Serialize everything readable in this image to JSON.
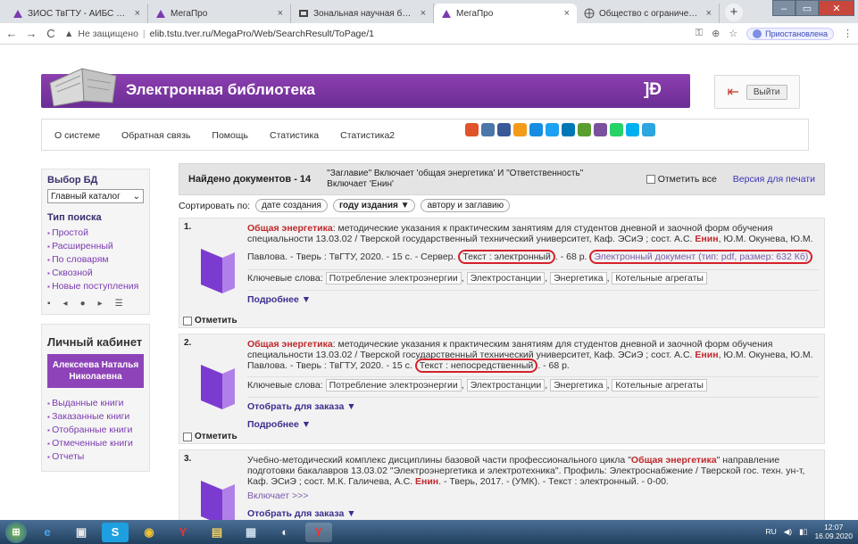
{
  "browser": {
    "tabs": [
      {
        "title": "ЗИОС ТвГТУ - АИБС МегаПро",
        "active": false,
        "icon": "megapro-icon"
      },
      {
        "title": "МегаПро",
        "active": false,
        "icon": "megapro-icon"
      },
      {
        "title": "Зональная научная библиотека",
        "active": false,
        "icon": "library-icon"
      },
      {
        "title": "МегаПро",
        "active": true,
        "icon": "megapro-icon"
      },
      {
        "title": "Общество с ограниченной отве",
        "active": false,
        "icon": "globe-icon"
      }
    ],
    "new_tab": "+",
    "not_secure_label": "Не защищено",
    "url": "elib.tstu.tver.ru/MegaPro/Web/SearchResult/ToPage/1",
    "profile_label": "Приостановлена"
  },
  "header": {
    "title": "Электронная библиотека",
    "mark": "]Ð",
    "logout_label": "Выйти"
  },
  "nav": {
    "items": [
      "О системе",
      "Обратная связь",
      "Помощь",
      "Статистика",
      "Статистика2"
    ],
    "social_colors": [
      "#e0532b",
      "#4a76a8",
      "#3b5998",
      "#f49c1a",
      "#168de2",
      "#1da1f2",
      "#0077b5",
      "#5a9e2f",
      "#7b519d",
      "#25d366",
      "#00aff0",
      "#2ca5e0"
    ]
  },
  "sidebar": {
    "db_heading": "Выбор БД",
    "db_selected": "Главный каталог",
    "search_heading": "Тип поиска",
    "search_types": [
      "Простой",
      "Расширенный",
      "По словарям",
      "Сквозной",
      "Новые поступления"
    ],
    "cabinet_heading": "Личный кабинет",
    "user_name": "Алексеева Наталья Николаевна",
    "cabinet_links": [
      "Выданные книги",
      "Заказанные книги",
      "Отобранные книги",
      "Отмеченные книги",
      "Отчеты"
    ]
  },
  "results": {
    "found_label": "Найдено документов - 14",
    "query_text": "\"Заглавие\" Включает 'общая энергетика' И \"Ответственность\" Включает 'Енин'",
    "mark_all": "Отметить все",
    "print_version": "Версия для печати",
    "sort_label": "Сортировать по:",
    "sort_options": [
      "дате создания",
      "году издания ▼",
      "автору и заглавию"
    ],
    "mark_label": "Отметить",
    "records": [
      {
        "num": "1.",
        "title": "Общая энергетика",
        "text_a": ": методические указания к практическим занятиям для студентов дневной и заочной форм обучения специальности 13.03.02 / Тверской государственный технический университет, Каф. ЭСиЭ ; сост. А.С. ",
        "author_hl": "Енин",
        "text_b": ", Ю.М. Окунева, Ю.М. Павлова. - Тверь : ТвГТУ, 2020. - 15 с. - Сервер.",
        "circled": "Текст : электронный",
        "text_c": ". - 68 р.",
        "elink": "Электронный документ (тип: pdf, размер: 632 Кб)",
        "keywords_label": "Ключевые слова:",
        "keywords": [
          "Потребление электроэнергии",
          "Электростанции",
          "Энергетика",
          "Котельные агрегаты"
        ],
        "more": "Подробнее ▼"
      },
      {
        "num": "2.",
        "title": "Общая энергетика",
        "text_a": ": методические указания к практическим занятиям для студентов дневной и заочной форм обучения специальности 13.03.02 / Тверской государственный технический университет, Каф. ЭСиЭ ; сост. А.С. ",
        "author_hl": "Енин",
        "text_b": ", Ю.М. Окунева, Ю.М. Павлова. - Тверь : ТвГТУ, 2020. - 15 с.",
        "circled": "Текст : непосредственный",
        "text_c": ". - 68 р.",
        "keywords_label": "Ключевые слова:",
        "keywords": [
          "Потребление электроэнергии",
          "Электростанции",
          "Энергетика",
          "Котельные агрегаты"
        ],
        "order": "Отобрать для заказа ▼",
        "more": "Подробнее ▼"
      },
      {
        "num": "3.",
        "text_pre": "Учебно-методический комплекс дисциплины базовой части профессионального цикла \"",
        "title": "Общая энергетика",
        "text_a": "\" направление подготовки бакалавров 13.03.02 \"Электроэнергетика и электротехника\". Профиль: Электроснабжение / Тверской гос. техн. ун-т, Каф. ЭСиЭ ; сост. М.К. Галичева, А.С. ",
        "author_hl": "Енин",
        "text_b": ". - Тверь, 2017. - (УМК). - Текст : электронный. - 0-00.",
        "includes": "Включает >>>",
        "order": "Отобрать для заказа ▼"
      }
    ]
  },
  "taskbar": {
    "items": [
      "e",
      "▣",
      "S",
      "◉",
      "Y",
      "▤",
      "▦",
      "◐",
      "Y"
    ],
    "lang": "RU",
    "time": "12:07",
    "date": "16.09.2020"
  }
}
